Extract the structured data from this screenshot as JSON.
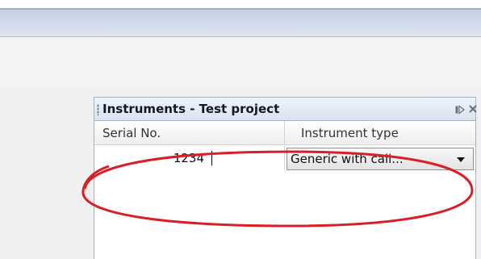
{
  "panel": {
    "title": "Instruments - Test project",
    "maximize_icon": "maximize-icon",
    "close_icon": "close-icon"
  },
  "table": {
    "columns": [
      "Serial No.",
      "Instrument type"
    ],
    "rows": [
      {
        "serial": "1234",
        "instrument_type": "Generic with cali..."
      }
    ]
  },
  "colors": {
    "annotation": "#d81e26",
    "title_bar": "#dde6f3"
  }
}
